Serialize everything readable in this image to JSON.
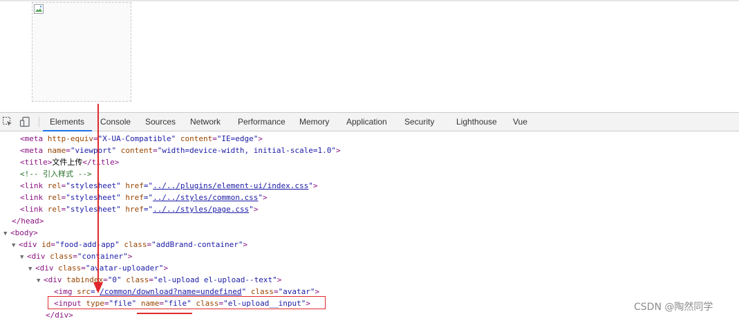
{
  "page": {
    "broken_image_alt": ""
  },
  "devtools": {
    "toolbar_icons": [
      "inspect-element-icon",
      "device-toggle-icon"
    ],
    "tabs": [
      {
        "label": "Elements",
        "active": true
      },
      {
        "label": "Console",
        "active": false
      },
      {
        "label": "Sources",
        "active": false
      },
      {
        "label": "Network",
        "active": false
      },
      {
        "label": "Performance",
        "active": false
      },
      {
        "label": "Memory",
        "active": false
      },
      {
        "label": "Application",
        "active": false
      },
      {
        "label": "Security",
        "active": false
      },
      {
        "label": "Lighthouse",
        "active": false
      },
      {
        "label": "Vue",
        "active": false
      }
    ],
    "accent_color": "#1a73e8"
  },
  "dom_tree": {
    "l0": {
      "open": "<meta",
      "a1": "http-equiv",
      "v1": "\"X-UA-Compatible\"",
      "a2": "content",
      "v2": "\"IE=edge\"",
      "close": ">"
    },
    "l1": {
      "open": "<meta",
      "a1": "name",
      "v1": "\"viewport\"",
      "a2": "content",
      "v2": "\"width=device-width, initial-scale=1.0\"",
      "close": ">"
    },
    "l2": {
      "open": "<title>",
      "text": "文件上传",
      "close": "</title>"
    },
    "l3": {
      "comment": "<!-- 引入样式 -->"
    },
    "l4": {
      "open": "<link",
      "a1": "rel",
      "v1": "\"stylesheet\"",
      "a2": "href",
      "q1": "=\"",
      "link": "../../plugins/element-ui/index.css",
      "q2": "\"",
      "close": ">"
    },
    "l5": {
      "open": "<link",
      "a1": "rel",
      "v1": "\"stylesheet\"",
      "a2": "href",
      "q1": "=\"",
      "link": "../../styles/common.css",
      "q2": "\"",
      "close": ">"
    },
    "l6": {
      "open": "<link",
      "a1": "rel",
      "v1": "\"stylesheet\"",
      "a2": "href",
      "q1": "=\"",
      "link": "../../styles/page.css",
      "q2": "\"",
      "close": ">"
    },
    "l7": {
      "close": "</head>"
    },
    "l8": {
      "open": "<body>"
    },
    "l9": {
      "open": "<div",
      "a1": "id",
      "v1": "\"food-add-app\"",
      "a2": "class",
      "v2": "\"addBrand-container\"",
      "close": ">"
    },
    "l10": {
      "open": "<div",
      "a1": "class",
      "v1": "\"container\"",
      "close": ">"
    },
    "l11": {
      "open": "<div",
      "a1": "class",
      "v1": "\"avatar-uploader\"",
      "close": ">"
    },
    "l12": {
      "open": "<div",
      "a1": "tabindex",
      "v1": "\"0\"",
      "a2": "class",
      "v2": "\"el-upload el-upload--text\"",
      "close": ">"
    },
    "l13": {
      "open": "<img",
      "a1": "src",
      "q1": "=\"",
      "link": "/common/download?name=undefined",
      "q2": "\"",
      "a2": "class",
      "v2": "\"avatar\"",
      "close": ">"
    },
    "l14": {
      "open": "<input",
      "a1": "type",
      "v1": "\"file\"",
      "a2": "name",
      "v2": "\"file\"",
      "a3": "class",
      "v3": "\"el-upload__input\"",
      "close": ">"
    },
    "l15": {
      "close": "</div>"
    }
  },
  "annotation": {
    "color": "#e0282a"
  },
  "watermark": {
    "text": "CSDN @陶然同学"
  }
}
